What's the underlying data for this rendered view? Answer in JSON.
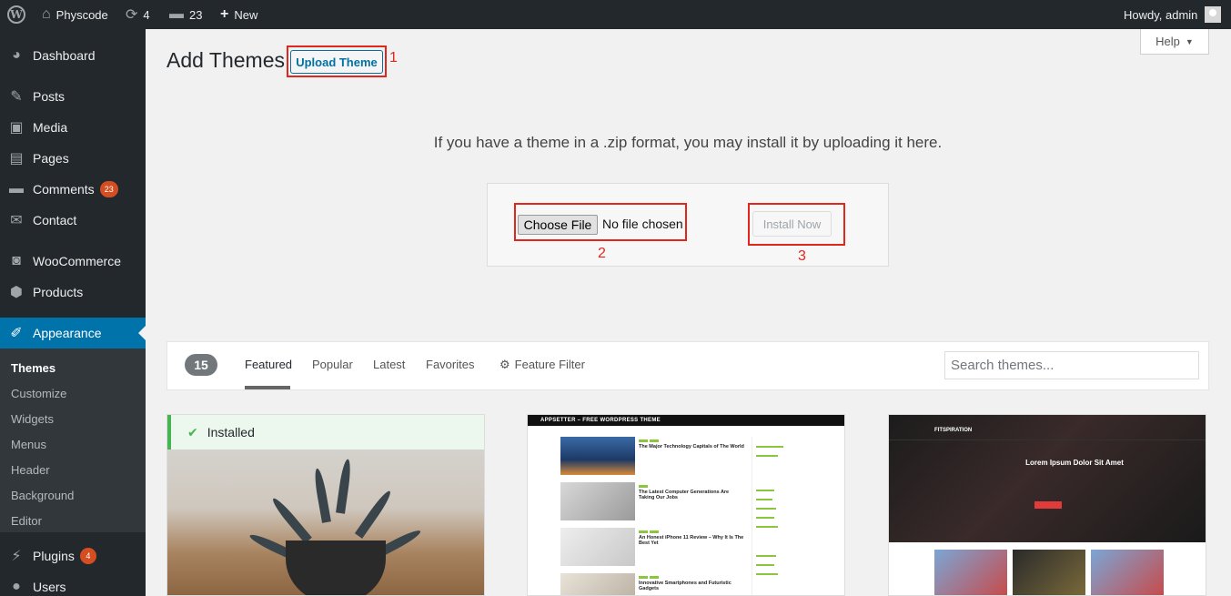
{
  "adminbar": {
    "site_name": "Physcode",
    "updates_count": "4",
    "comments_count": "23",
    "new_label": "New",
    "greeting": "Howdy, admin"
  },
  "sidebar": {
    "items": [
      {
        "label": "Dashboard",
        "icon": "dashboard-icon"
      },
      {
        "label": "Posts",
        "icon": "pin-icon"
      },
      {
        "label": "Media",
        "icon": "media-icon"
      },
      {
        "label": "Pages",
        "icon": "pages-icon"
      },
      {
        "label": "Comments",
        "icon": "comment-icon",
        "badge": "23"
      },
      {
        "label": "Contact",
        "icon": "envelope-icon"
      },
      {
        "label": "WooCommerce",
        "icon": "woo-icon"
      },
      {
        "label": "Products",
        "icon": "box-icon"
      },
      {
        "label": "Appearance",
        "icon": "brush-icon"
      },
      {
        "label": "Plugins",
        "icon": "plug-icon",
        "badge": "4"
      },
      {
        "label": "Users",
        "icon": "user-icon"
      }
    ],
    "submenu": [
      "Themes",
      "Customize",
      "Widgets",
      "Menus",
      "Header",
      "Background",
      "Editor"
    ]
  },
  "header": {
    "title": "Add Themes",
    "upload_button": "Upload Theme",
    "help": "Help"
  },
  "annotations": [
    "1",
    "2",
    "3"
  ],
  "upload": {
    "description": "If you have a theme in a .zip format, you may install it by uploading it here.",
    "choose_file": "Choose File",
    "no_file": "No file chosen",
    "install_now": "Install Now"
  },
  "filter": {
    "count": "15",
    "tabs": [
      "Featured",
      "Popular",
      "Latest",
      "Favorites"
    ],
    "feature_filter": "Feature Filter",
    "search_placeholder": "Search themes..."
  },
  "themes": {
    "installed_label": "Installed",
    "appsetter_header": "APPSETTER – FREE WORDPRESS THEME",
    "appsetter_posts": [
      "The Major Technology Capitals of The World",
      "The Latest Computer Generations Are Taking Our Jobs",
      "An Honest iPhone 11 Review – Why It Is The Best Yet",
      "Innovative Smartphones and Futuristic Gadgets"
    ],
    "fitspiration_logo": "FITSPIRATION",
    "fitspiration_title": "Lorem Ipsum Dolor Sit Amet"
  },
  "colors": {
    "admin_dark": "#23282d",
    "accent": "#0073aa",
    "annotation_red": "#e1261c",
    "installed_green": "#46b450",
    "badge_orange": "#d54e21"
  }
}
